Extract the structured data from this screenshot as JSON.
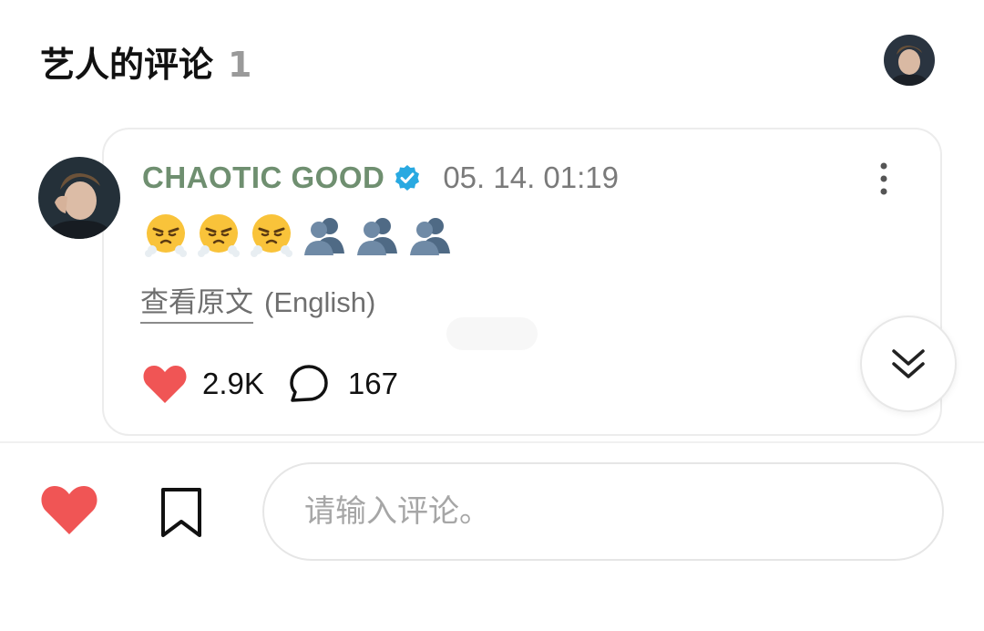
{
  "header": {
    "title": "艺人的评论",
    "count": "1"
  },
  "comment": {
    "author": "CHAOTIC GOOD",
    "timestamp": "05. 14. 01:19",
    "emojis": [
      "steam-face-emoji",
      "steam-face-emoji",
      "steam-face-emoji",
      "busts-in-silhouette-emoji",
      "busts-in-silhouette-emoji",
      "busts-in-silhouette-emoji"
    ],
    "translate_label": "查看原文",
    "translate_lang": "(English)",
    "likes": "2.9K",
    "replies": "167"
  },
  "composer": {
    "placeholder": "请输入评论。"
  },
  "colors": {
    "like_red": "#f05555",
    "author_green": "#6f8f70",
    "verified_blue": "#29a9e1"
  }
}
